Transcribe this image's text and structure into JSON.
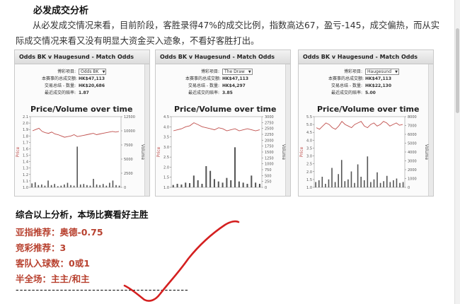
{
  "heading": "必发成交分析",
  "paragraph": "从必发成交情况来看，目前阶段，客胜录得47%的成交比例，指数高达67，盈亏-145，成交偏热，而从实际成交情况来看又没有明显大资金买入迹象，不看好客胜打出。",
  "panels": [
    {
      "title": "Odds BK v Haugesund - Match Odds",
      "select_label": "博彩项目:",
      "select_value": "Odds BK",
      "total_label": "本赛事的总成交额:",
      "total_value": "HK$47,113",
      "volume_label": "交易总结 - 数量:",
      "volume_value": "HK$20,686",
      "odds_label": "最近成交的赔率:",
      "odds_value": "1.87",
      "chart_title": "Price/Volume over time",
      "left_axis_label": "Price",
      "right_axis_label": "Volume"
    },
    {
      "title": "Odds BK v Haugesund - Match Odds",
      "select_label": "博彩项目:",
      "select_value": "The Draw",
      "total_label": "本赛事的总成交额:",
      "total_value": "HK$47,113",
      "volume_label": "交易总结 - 数量:",
      "volume_value": "HK$4,297",
      "odds_label": "最近成交的赔率:",
      "odds_value": "3.85",
      "chart_title": "Price/Volume over time",
      "left_axis_label": "Price",
      "right_axis_label": "Volume"
    },
    {
      "title": "Odds BK v Haugesund - Match Odds",
      "select_label": "博彩项目:",
      "select_value": "Haugesund",
      "total_label": "本赛事的总成交额:",
      "total_value": "HK$47,113",
      "volume_label": "交易总结 - 数量:",
      "volume_value": "HK$22,130",
      "odds_label": "最近成交的赔率:",
      "odds_value": "5.00",
      "chart_title": "Price/Volume over time",
      "left_axis_label": "Price",
      "right_axis_label": "Volume"
    }
  ],
  "chart_data": [
    {
      "type": "line",
      "title": "Price/Volume over time",
      "ylabel": "Price",
      "y2label": "Volume",
      "yticks": [
        "1.0",
        "1.1",
        "1.2",
        "1.3",
        "1.4",
        "1.5",
        "1.6",
        "1.7",
        "1.8",
        "1.9",
        "2.0",
        "2.1"
      ],
      "y2ticks": [
        "0",
        "2500",
        "5000",
        "7500",
        "10000",
        "12500"
      ],
      "ylim": [
        1.0,
        2.1
      ],
      "y2lim": [
        0,
        12500
      ],
      "price": [
        1.88,
        1.9,
        1.92,
        1.87,
        1.85,
        1.84,
        1.86,
        1.83,
        1.82,
        1.8,
        1.78,
        1.79,
        1.8,
        1.82,
        1.79,
        1.8,
        1.81,
        1.82,
        1.83,
        1.84,
        1.82,
        1.83,
        1.84,
        1.85,
        1.86,
        1.87,
        1.86,
        1.87
      ],
      "volume": [
        700,
        900,
        400,
        500,
        300,
        1200,
        400,
        600,
        200,
        300,
        500,
        800,
        400,
        300,
        7200,
        500,
        600,
        400,
        300,
        1500,
        500,
        400,
        600,
        300,
        800,
        1200,
        400,
        300
      ]
    },
    {
      "type": "line",
      "title": "Price/Volume over time",
      "ylabel": "Price",
      "y2label": "Volume",
      "yticks": [
        "1.0",
        "1.5",
        "2.0",
        "2.5",
        "3.0",
        "3.5",
        "4.0",
        "4.5"
      ],
      "y2ticks": [
        "0",
        "250",
        "500",
        "750",
        "1000",
        "1250",
        "1500",
        "1750",
        "2000",
        "2250",
        "2500",
        "2750",
        "3000"
      ],
      "ylim": [
        1.0,
        4.5
      ],
      "y2lim": [
        0,
        3000
      ],
      "price": [
        3.8,
        3.85,
        3.9,
        4.0,
        4.05,
        4.2,
        4.1,
        4.0,
        3.95,
        3.9,
        3.85,
        3.95,
        3.9,
        3.8,
        3.85,
        3.9,
        3.8,
        3.85,
        3.9,
        3.85,
        3.8,
        3.85
      ],
      "volume": [
        100,
        150,
        120,
        200,
        180,
        500,
        300,
        150,
        900,
        700,
        350,
        250,
        200,
        400,
        300,
        1700,
        250,
        200,
        150,
        500,
        200,
        150
      ]
    },
    {
      "type": "line",
      "title": "Price/Volume over time",
      "ylabel": "Price",
      "y2label": "Volume",
      "yticks": [
        "1.0",
        "1.5",
        "2.0",
        "2.5",
        "3.0",
        "3.5",
        "4.0",
        "4.5",
        "5.0",
        "5.5"
      ],
      "y2ticks": [
        "0",
        "1000",
        "2000",
        "3000",
        "4000",
        "5000",
        "6000",
        "7000",
        "8000"
      ],
      "ylim": [
        1.0,
        5.5
      ],
      "y2lim": [
        0,
        8000
      ],
      "price": [
        4.8,
        4.7,
        4.9,
        5.1,
        5.0,
        4.8,
        4.7,
        4.9,
        5.2,
        5.0,
        4.9,
        4.8,
        5.0,
        5.1,
        5.2,
        4.9,
        4.8,
        5.0,
        5.1,
        4.9,
        5.0,
        5.2,
        5.1,
        4.9,
        5.0,
        5.1,
        4.95,
        5.0
      ],
      "volume": [
        600,
        800,
        1200,
        400,
        900,
        2200,
        600,
        1500,
        3100,
        700,
        900,
        1800,
        500,
        2600,
        1200,
        800,
        3500,
        600,
        900,
        1700,
        500,
        700,
        1300,
        600,
        800,
        1000,
        500,
        600
      ]
    }
  ],
  "summary_title": "综合以上分析，本场比赛看好主胜",
  "recommendations": [
    {
      "label": "亚指推荐：",
      "value": "奥德-0.75"
    },
    {
      "label": "竞彩推荐：",
      "value": "3"
    },
    {
      "label": "客队入球数：",
      "value": "0或1"
    },
    {
      "label": "半全场：",
      "value": "主主/和主"
    }
  ],
  "divider": "-------------------------------------------",
  "colors": {
    "price_line": "#c0504d",
    "volume_bar": "#555555",
    "recommend_text": "#b8412f",
    "scribble": "#d42020"
  }
}
